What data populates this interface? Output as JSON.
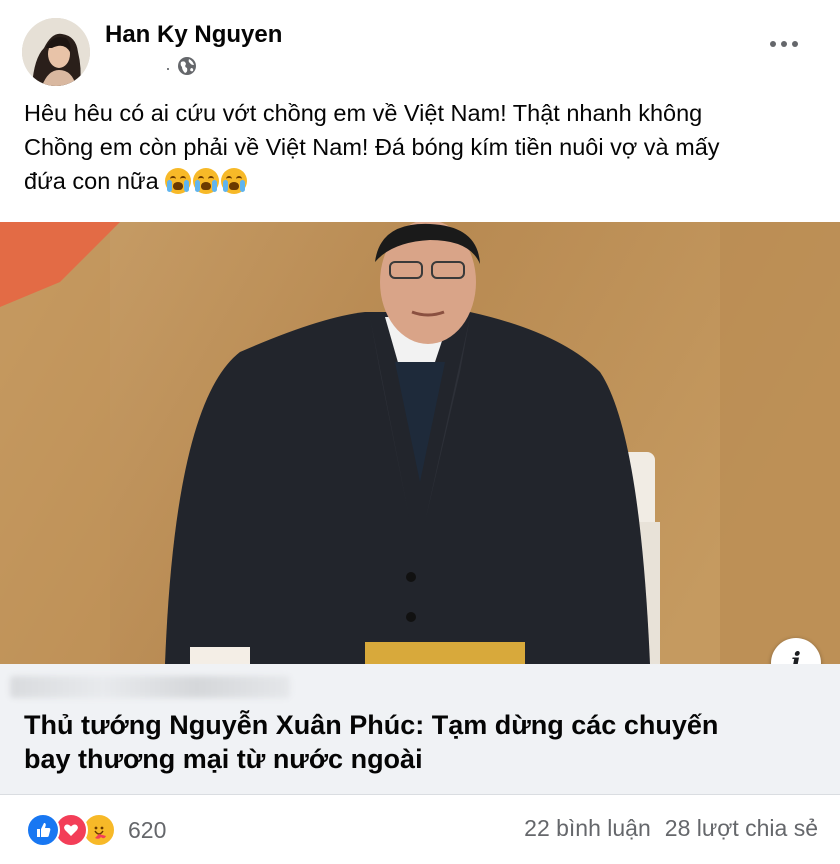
{
  "post": {
    "author": "Han Ky Nguyen",
    "meta_dot": "·",
    "audience_icon": "globe-icon",
    "text_lines": [
      "Hêu hêu có ai cứu vớt chồng em về Việt Nam! Thật nhanh không",
      "Chồng em còn phải về Việt Nam! Đá bóng kím tiền nuôi vợ và mấy",
      "đứa con nữa"
    ],
    "emojis": [
      "loudly-crying-face",
      "loudly-crying-face",
      "loudly-crying-face"
    ]
  },
  "link": {
    "title_lines": [
      "Thủ tướng Nguyễn Xuân Phúc: Tạm dừng các chuyến",
      "bay thương mại từ nước ngoài"
    ],
    "info_label": "i"
  },
  "footer": {
    "reaction_icons": [
      "like-icon",
      "love-icon",
      "care-icon"
    ],
    "reaction_count": "620",
    "comments": "22 bình luận",
    "shares": "28 lượt chia sẻ"
  },
  "colors": {
    "text": "#050505",
    "secondary": "#65676b",
    "link_bg": "#f0f2f5",
    "like": "#1877f2",
    "love": "#f33e58",
    "care": "#f7b928"
  }
}
